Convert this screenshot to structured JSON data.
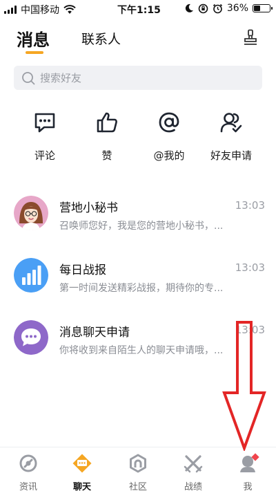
{
  "status_bar": {
    "carrier": "中国移动",
    "time": "下午1:15",
    "battery": "36%",
    "battery_level": 0.36
  },
  "header": {
    "tab_messages": "消息",
    "tab_contacts": "联系人",
    "right_icon": "stamp-icon"
  },
  "search": {
    "placeholder": "搜索好友"
  },
  "quick_actions": [
    {
      "label": "评论",
      "icon": "comment-icon"
    },
    {
      "label": "赞",
      "icon": "thumbs-up-icon"
    },
    {
      "label": "@我的",
      "icon": "at-icon"
    },
    {
      "label": "好友申请",
      "icon": "friend-request-icon"
    }
  ],
  "messages": [
    {
      "title": "营地小秘书",
      "time": "13:03",
      "preview": "召唤师您好，我是您的营地小秘书，..."
    },
    {
      "title": "每日战报",
      "time": "13:03",
      "preview": "第一时间发送精彩战报，期待你的专..."
    },
    {
      "title": "消息聊天申请",
      "time": "13:03",
      "preview": "你将收到来自陌生人的聊天申请哦，..."
    }
  ],
  "bottom_nav": [
    {
      "label": "资讯",
      "icon": "news-icon"
    },
    {
      "label": "聊天",
      "icon": "chat-icon",
      "active": true
    },
    {
      "label": "社区",
      "icon": "community-icon"
    },
    {
      "label": "战绩",
      "icon": "record-icon"
    },
    {
      "label": "我",
      "icon": "profile-icon"
    }
  ],
  "colors": {
    "accent": "#f5a623",
    "badge": "#f0454d",
    "annotation": "#e32626"
  }
}
